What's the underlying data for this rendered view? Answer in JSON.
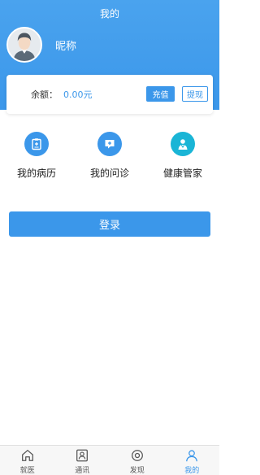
{
  "header": {
    "title": "我的",
    "nickname": "昵称"
  },
  "balance": {
    "label": "余额：",
    "value": "0.00元",
    "recharge_label": "充值",
    "withdraw_label": "提现"
  },
  "grid": [
    {
      "label": "我的病历",
      "icon": "medical-record-icon"
    },
    {
      "label": "我的问诊",
      "icon": "consultation-icon"
    },
    {
      "label": "健康管家",
      "icon": "doctor-icon"
    }
  ],
  "login_label": "登录",
  "tabs": [
    {
      "label": "就医",
      "icon": "home-icon",
      "active": false
    },
    {
      "label": "通讯",
      "icon": "contacts-icon",
      "active": false
    },
    {
      "label": "发现",
      "icon": "discover-icon",
      "active": false
    },
    {
      "label": "我的",
      "icon": "user-icon",
      "active": true
    }
  ],
  "colors": {
    "accent": "#3b97ea",
    "doctor_icon": "#1ab5d6"
  }
}
